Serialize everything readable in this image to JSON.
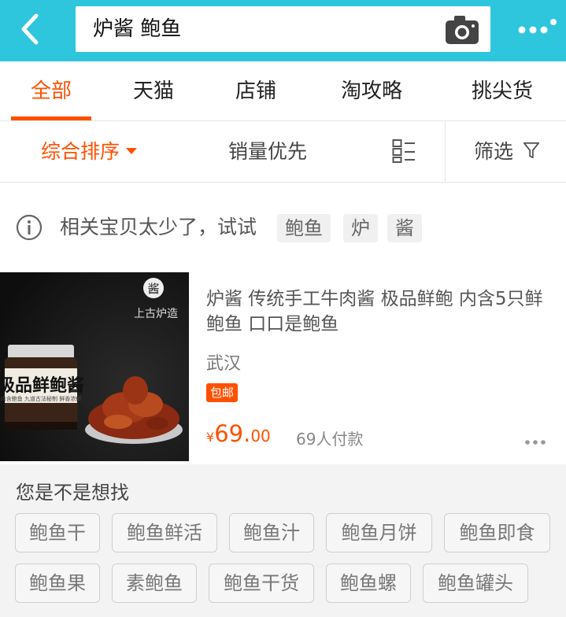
{
  "search": {
    "query": "炉酱 鲍鱼"
  },
  "tabs": [
    {
      "label": "全部"
    },
    {
      "label": "天猫"
    },
    {
      "label": "店铺"
    },
    {
      "label": "淘攻略"
    },
    {
      "label": "挑尖货"
    }
  ],
  "sort": {
    "comprehensive": "综合排序",
    "sales": "销量优先",
    "filter": "筛选"
  },
  "hint": {
    "text": "相关宝贝太少了，试试",
    "chips": [
      "鲍鱼",
      "炉",
      "酱"
    ]
  },
  "product": {
    "image_text": {
      "brand_seal": "酱",
      "brand": "上古炉造",
      "jar_label": "极品鲜鲍酱",
      "jar_subtext": "内含鲍鱼 九道古法秘制 鲜香浓郁"
    },
    "title": "炉酱 传统手工牛肉酱 极品鲜鲍 内含5只鲜鲍鱼 口口是鲍鱼",
    "location": "武汉",
    "badge": "包邮",
    "price_currency": "¥",
    "price_int": "69.",
    "price_dec": "00",
    "paid": "69人付款"
  },
  "suggestions": {
    "title": "您是不是想找",
    "tags": [
      "鲍鱼干",
      "鲍鱼鲜活",
      "鲍鱼汁",
      "鲍鱼月饼",
      "鲍鱼即食",
      "鲍鱼果",
      "素鲍鱼",
      "鲍鱼干货",
      "鲍鱼螺",
      "鲍鱼罐头"
    ]
  },
  "colors": {
    "header": "#2ec6dd",
    "accent": "#ff5000"
  },
  "icons": {
    "back": "chevron-left-icon",
    "camera": "camera-icon",
    "more": "more-dots-icon",
    "grid": "list-view-icon",
    "filter": "funnel-icon",
    "info": "info-circle-icon"
  }
}
